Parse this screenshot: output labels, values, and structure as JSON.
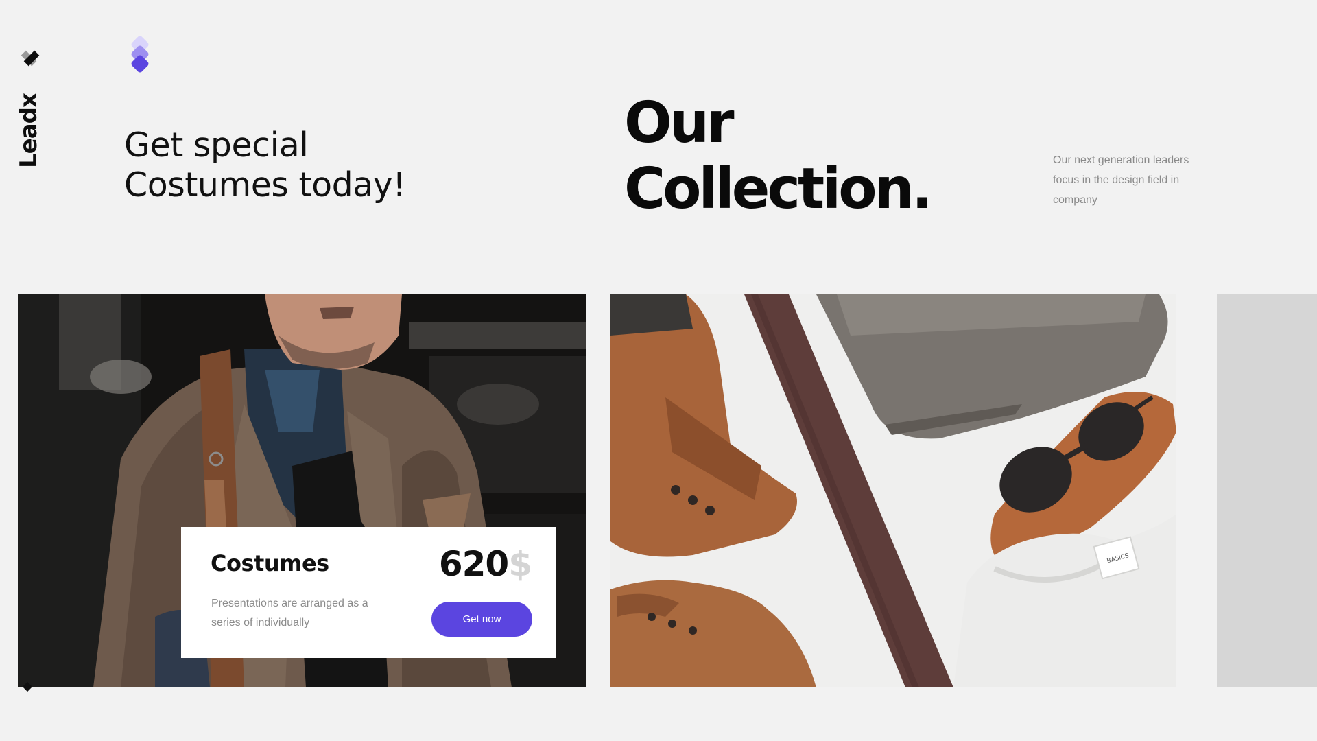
{
  "brand": {
    "name": "Leadx",
    "logo_icon": "x-logo-icon",
    "layers_icon": "layers-icon",
    "accent_color": "#5b45e0"
  },
  "header": {
    "tagline_line1": "Get special",
    "tagline_line2": "Costumes today!",
    "title_line1": "Our",
    "title_line2": "Collection.",
    "intro": "Our next generation leaders focus in the design field in company"
  },
  "product": {
    "name": "Costumes",
    "description": "Presentations are arranged as a series of individually",
    "price": "620",
    "currency": "$",
    "cta_label": "Get now"
  },
  "gallery": {
    "items": [
      "man-in-tweed-jacket-photo",
      "flatlay-accessories-photo",
      "next-card-placeholder"
    ]
  }
}
